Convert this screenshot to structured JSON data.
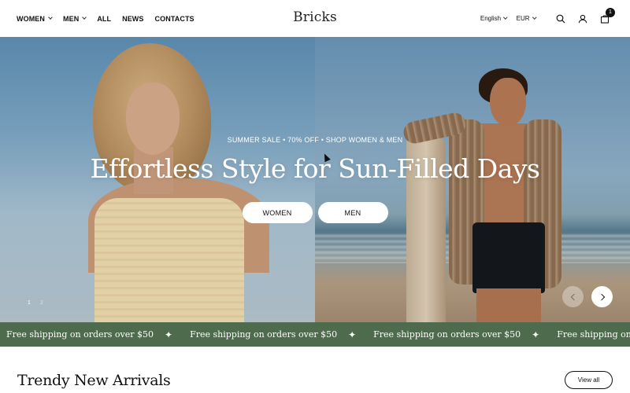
{
  "header": {
    "nav": [
      {
        "label": "WOMEN",
        "has_dropdown": true
      },
      {
        "label": "MEN",
        "has_dropdown": true
      },
      {
        "label": "ALL",
        "has_dropdown": false
      },
      {
        "label": "NEWS",
        "has_dropdown": false
      },
      {
        "label": "CONTACTS",
        "has_dropdown": false
      }
    ],
    "logo": "Bricks",
    "language": "English",
    "currency": "EUR",
    "cart_count": "1",
    "icons": {
      "search": "search-icon",
      "account": "user-icon",
      "cart": "bag-icon"
    }
  },
  "hero": {
    "subtitle": "SUMMER SALE • 70% OFF • SHOP WOMEN & MEN",
    "title": "Effortless Style for Sun-Filled Days",
    "buttons": [
      {
        "label": "WOMEN"
      },
      {
        "label": "MEN"
      }
    ],
    "pager": {
      "current": "1",
      "total": "2"
    }
  },
  "marquee": {
    "text": "Free shipping on orders over $50",
    "separator_icon": "sparkle-icon"
  },
  "section": {
    "title": "Trendy New Arrivals",
    "view_all": "View all"
  },
  "colors": {
    "marquee_bg": "#4f6b4d",
    "text": "#111111",
    "background": "#ffffff"
  }
}
